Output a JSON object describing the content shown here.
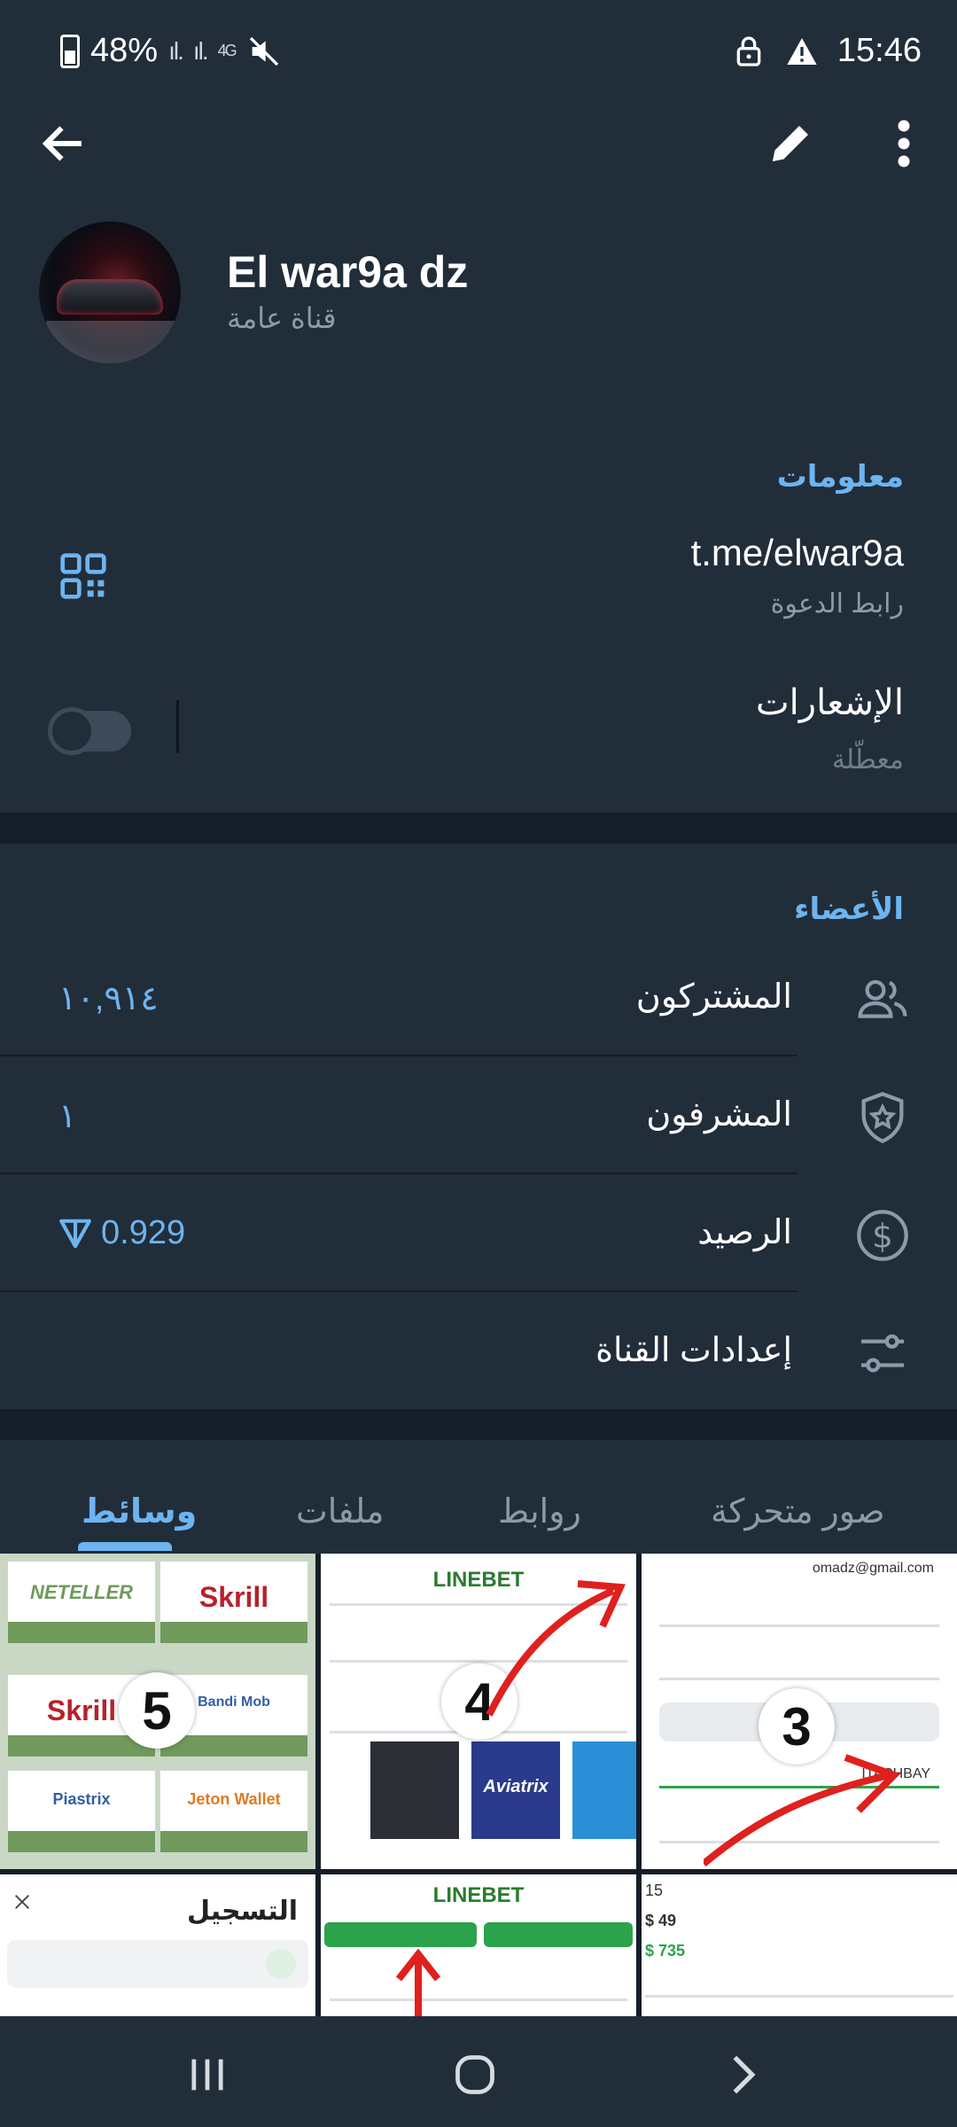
{
  "status_bar": {
    "battery": "48%",
    "network": "4G",
    "time": "15:46"
  },
  "header": {
    "channel_name": "El war9a dz",
    "channel_type": "قناة عامة"
  },
  "info": {
    "section_title": "معلومات",
    "link": "t.me/elwar9a",
    "link_label": "رابط الدعوة",
    "notifications_label": "الإشعارات",
    "notifications_status": "معطّلة"
  },
  "members": {
    "section_title": "الأعضاء",
    "rows": [
      {
        "label": "المشتركون",
        "value": "١٠,٩١٤",
        "icon": "people-icon"
      },
      {
        "label": "المشرفون",
        "value": "١",
        "icon": "shield-star-icon"
      },
      {
        "label": "الرصيد",
        "value": "0.929",
        "icon": "dollar-circle-icon"
      },
      {
        "label": "إعدادات القناة",
        "value": "",
        "icon": "sliders-icon"
      }
    ]
  },
  "tabs": [
    {
      "label": "وسائط",
      "active": true
    },
    {
      "label": "ملفات",
      "active": false
    },
    {
      "label": "روابط",
      "active": false
    },
    {
      "label": "صور متحركة",
      "active": false
    }
  ],
  "media": {
    "tile1": {
      "badge": "5",
      "payments": [
        "NETELLER",
        "Skrill",
        "Skrill",
        "Bandi Mob",
        "Piastrix",
        "Jeton Wallet"
      ]
    },
    "tile2": {
      "badge": "4",
      "brand": "LINEBET",
      "promo": "Aviatrix"
    },
    "tile3": {
      "badge": "3",
      "email": "omadz@gmail.com",
      "code": "ITACHBAY"
    },
    "tile4": {
      "title": "التسجيل"
    },
    "tile5": {
      "brand": "LINEBET"
    },
    "tile6": {
      "values": [
        "15",
        "$ 49",
        "$ 735"
      ]
    }
  },
  "colors": {
    "accent": "#6db4f0",
    "background": "#151d28",
    "card": "#222d3a",
    "muted_text": "#8c9aa9"
  }
}
